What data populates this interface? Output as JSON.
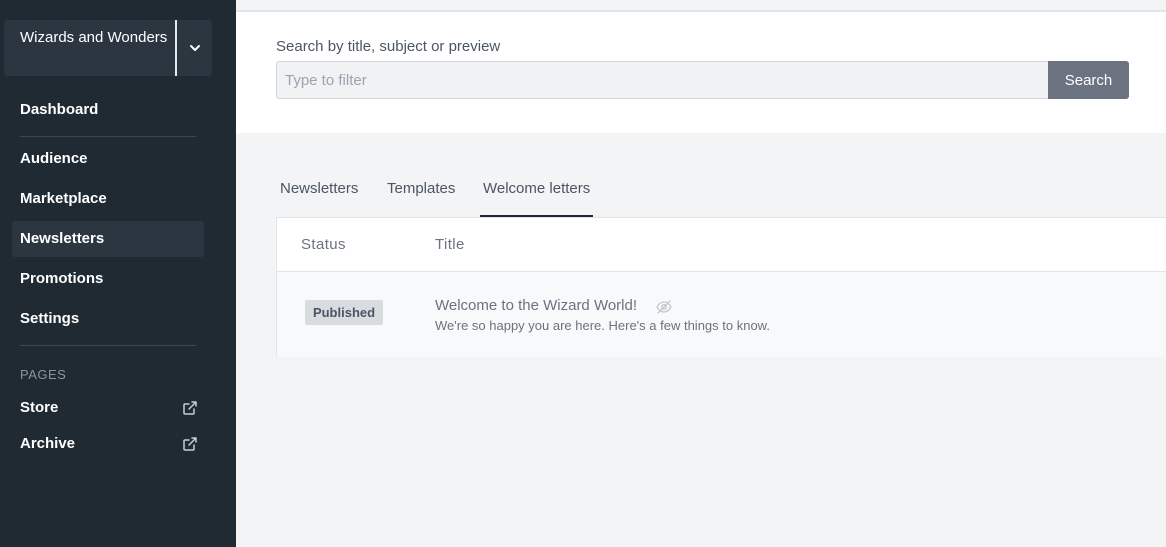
{
  "sidebar": {
    "account": {
      "name": "Wizards and Wonders"
    },
    "nav": [
      {
        "label": "Dashboard"
      },
      {
        "label": "Audience"
      },
      {
        "label": "Marketplace"
      },
      {
        "label": "Newsletters",
        "active": true
      },
      {
        "label": "Promotions"
      },
      {
        "label": "Settings"
      }
    ],
    "pages_title": "PAGES",
    "pages": [
      {
        "label": "Store",
        "icon": "external-link-icon"
      },
      {
        "label": "Archive",
        "icon": "external-link-icon"
      }
    ]
  },
  "search": {
    "label": "Search by title, subject or preview",
    "placeholder": "Type to filter",
    "value": "",
    "button_label": "Search"
  },
  "tabs": [
    {
      "label": "Newsletters"
    },
    {
      "label": "Templates"
    },
    {
      "label": "Welcome letters",
      "active": true
    }
  ],
  "table": {
    "columns": [
      "Status",
      "Title"
    ],
    "rows": [
      {
        "status": "Published",
        "title": "Welcome to the Wizard World!",
        "subtitle": "We're so happy you are here. Here's a few things to know.",
        "icon": "eye-off-icon"
      }
    ]
  },
  "colors": {
    "sidebar_bg": "#1f2a33",
    "sidebar_active": "#2b3640",
    "button_bg": "#6b7280",
    "badge_bg": "#d8dbe0"
  }
}
